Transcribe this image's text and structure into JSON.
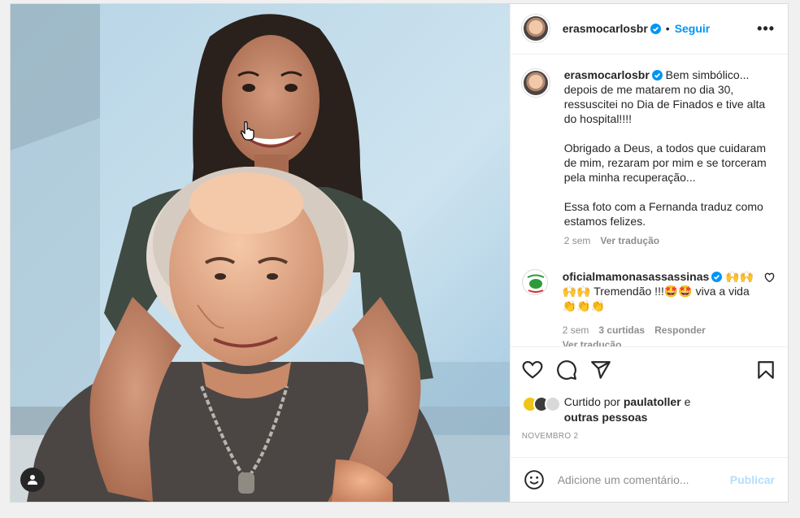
{
  "post": {
    "username": "erasmocarlosbr",
    "follow_label": "Seguir",
    "more_label": "•••",
    "dot": "•"
  },
  "caption": {
    "username": "erasmocarlosbr",
    "paragraph_1": "Bem simbólico... depois de me matarem no dia 30, ressuscitei no Dia de Finados e tive alta do hospital!!!!",
    "paragraph_2": "Obrigado a Deus, a todos que cuidaram de mim, rezaram por mim e se torceram pela minha recuperação...",
    "paragraph_3": "Essa foto com a Fernanda traduz como estamos felizes.",
    "time": "2 sem",
    "translate": "Ver tradução"
  },
  "comment": {
    "username": "oficialmamonasassassinas",
    "text": "🙌🙌🙌🙌 Tremendão !!!🤩🤩 viva a vida 👏👏👏",
    "time": "2 sem",
    "likes": "3 curtidas",
    "reply": "Responder",
    "translate": "Ver tradução"
  },
  "likes": {
    "prefix": "Curtido por",
    "user": "paulatoller",
    "connector": "e",
    "others": "outras pessoas"
  },
  "date": "NOVEMBRO 2",
  "add_comment": {
    "placeholder": "Adicione um comentário...",
    "publish": "Publicar"
  },
  "colors": {
    "accent": "#0095f6",
    "publish_disabled": "#b2dffc",
    "muted": "#8e8e8e",
    "text": "#262626"
  },
  "icons": [
    "verified-badge-icon",
    "heart-icon",
    "comment-icon",
    "share-icon",
    "bookmark-icon",
    "emoji-icon",
    "user-tag-icon",
    "hand-cursor-icon"
  ]
}
